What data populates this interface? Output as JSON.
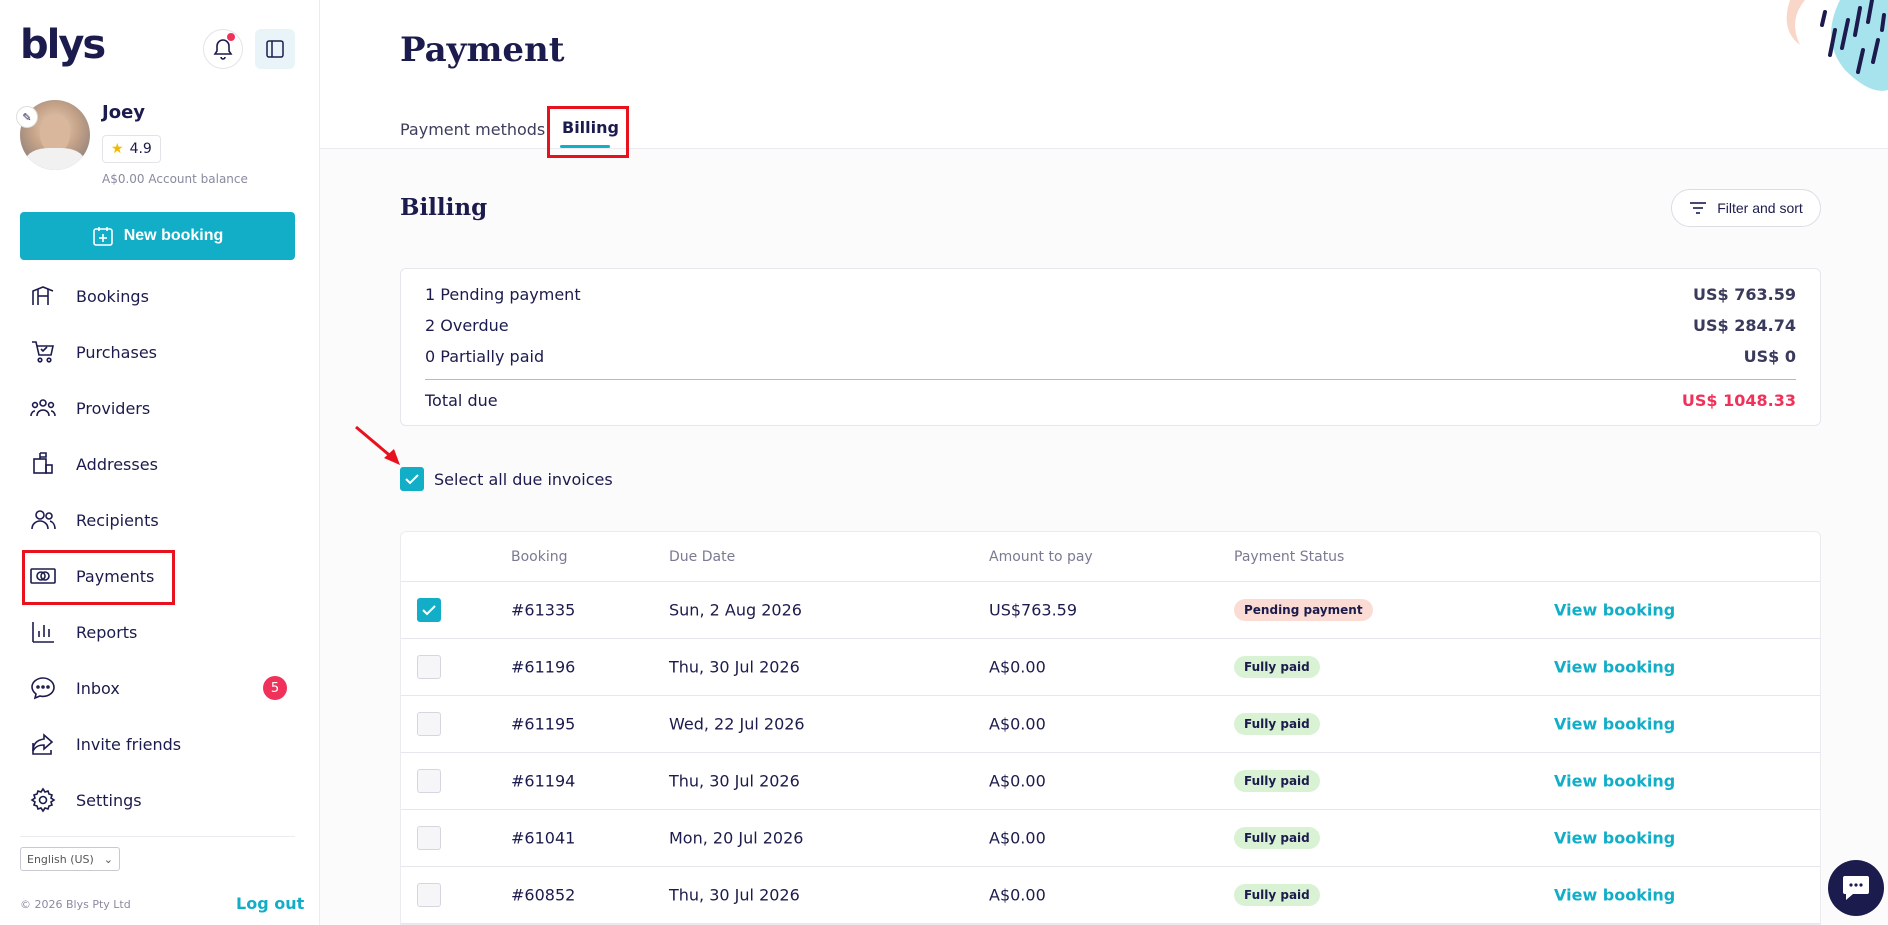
{
  "app": {
    "logo": "blys"
  },
  "user": {
    "name": "Joey",
    "rating": "4.9",
    "balance": "A$0.00 Account balance"
  },
  "actions": {
    "new_booking": "New booking"
  },
  "nav": [
    {
      "label": "Bookings",
      "icon": "booking-icon"
    },
    {
      "label": "Purchases",
      "icon": "cart-icon"
    },
    {
      "label": "Providers",
      "icon": "providers-icon"
    },
    {
      "label": "Addresses",
      "icon": "address-icon"
    },
    {
      "label": "Recipients",
      "icon": "recipients-icon"
    },
    {
      "label": "Payments",
      "icon": "payments-icon"
    },
    {
      "label": "Reports",
      "icon": "reports-icon"
    },
    {
      "label": "Inbox",
      "icon": "inbox-icon",
      "badge": "5"
    },
    {
      "label": "Invite friends",
      "icon": "share-icon"
    },
    {
      "label": "Settings",
      "icon": "gear-icon"
    }
  ],
  "footer": {
    "language": "English (US)",
    "copyright": "© 2026 Blys Pty Ltd",
    "logout": "Log out"
  },
  "page": {
    "title": "Payment",
    "tabs": [
      {
        "label": "Payment methods"
      },
      {
        "label": "Billing",
        "active": true
      }
    ],
    "section_title": "Billing",
    "filter_label": "Filter and sort"
  },
  "summary": {
    "rows": [
      {
        "label": "1 Pending payment",
        "value": "US$ 763.59"
      },
      {
        "label": "2 Overdue",
        "value": "US$ 284.74"
      },
      {
        "label": "0 Partially paid",
        "value": "US$ 0"
      }
    ],
    "total": {
      "label": "Total due",
      "value": "US$ 1048.33"
    }
  },
  "select_all": {
    "label": "Select all due invoices",
    "checked": true
  },
  "table": {
    "headers": {
      "booking": "Booking",
      "due_date": "Due Date",
      "amount": "Amount to pay",
      "status": "Payment Status"
    },
    "view_label": "View booking",
    "rows": [
      {
        "checked": true,
        "booking": "#61335",
        "due": "Sun, 2 Aug 2026",
        "amount": "US$763.59",
        "status": "Pending payment",
        "kind": "pending"
      },
      {
        "checked": false,
        "booking": "#61196",
        "due": "Thu, 30 Jul 2026",
        "amount": "A$0.00",
        "status": "Fully paid",
        "kind": "paid"
      },
      {
        "checked": false,
        "booking": "#61195",
        "due": "Wed, 22 Jul 2026",
        "amount": "A$0.00",
        "status": "Fully paid",
        "kind": "paid"
      },
      {
        "checked": false,
        "booking": "#61194",
        "due": "Thu, 30 Jul 2026",
        "amount": "A$0.00",
        "status": "Fully paid",
        "kind": "paid"
      },
      {
        "checked": false,
        "booking": "#61041",
        "due": "Mon, 20 Jul 2026",
        "amount": "A$0.00",
        "status": "Fully paid",
        "kind": "paid"
      },
      {
        "checked": false,
        "booking": "#60852",
        "due": "Thu, 30 Jul 2026",
        "amount": "A$0.00",
        "status": "Fully paid",
        "kind": "paid"
      }
    ]
  },
  "colors": {
    "accent": "#12aec7",
    "navy": "#1c1b4d",
    "alert": "#f0325a",
    "highlight": "#e8121f"
  }
}
